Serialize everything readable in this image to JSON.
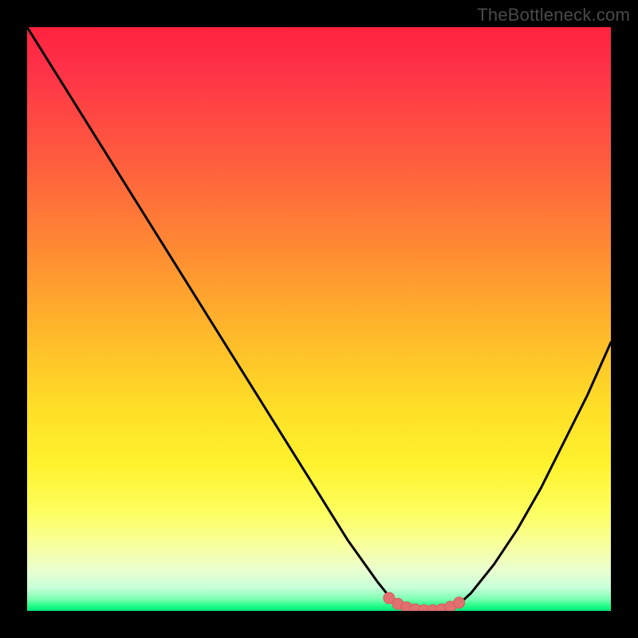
{
  "watermark": "TheBottleneck.com",
  "colors": {
    "curve_stroke": "#000000",
    "marker_fill": "#e07070",
    "marker_stroke": "#d85a5a"
  },
  "chart_data": {
    "type": "line",
    "title": "",
    "xlabel": "",
    "ylabel": "",
    "xlim": [
      0,
      100
    ],
    "ylim": [
      0,
      100
    ],
    "grid": false,
    "legend": false,
    "series": [
      {
        "name": "bottleneck-curve",
        "x": [
          0,
          5,
          10,
          15,
          20,
          25,
          30,
          35,
          40,
          45,
          50,
          55,
          60,
          62,
          64,
          66,
          68,
          70,
          72,
          74,
          76,
          80,
          84,
          88,
          92,
          96,
          100
        ],
        "values": [
          100,
          92,
          84,
          76,
          68,
          60,
          52,
          44,
          36,
          28,
          20,
          12,
          5,
          2.5,
          1,
          0.3,
          0.1,
          0.1,
          0.3,
          1.2,
          3,
          8,
          14,
          21,
          29,
          37,
          46
        ]
      }
    ],
    "markers": [
      {
        "x": 62.0,
        "y": 2.2
      },
      {
        "x": 63.5,
        "y": 1.2
      },
      {
        "x": 65.0,
        "y": 0.6
      },
      {
        "x": 66.5,
        "y": 0.25
      },
      {
        "x": 68.0,
        "y": 0.12
      },
      {
        "x": 69.5,
        "y": 0.12
      },
      {
        "x": 71.0,
        "y": 0.25
      },
      {
        "x": 72.5,
        "y": 0.7
      },
      {
        "x": 74.0,
        "y": 1.4
      }
    ]
  }
}
